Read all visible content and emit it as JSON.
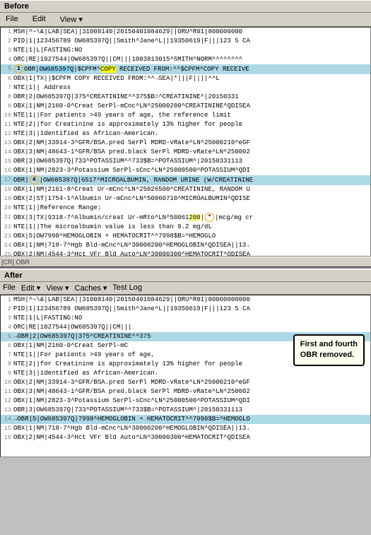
{
  "before": {
    "section_label": "Before",
    "menubar": [
      "File",
      "Edit",
      "View"
    ],
    "lines": [
      {
        "num": "1",
        "text": "MSH|^~\\&|LAB|SEA||31008140|20150401084629||ORU^R01|800000000",
        "hl": ""
      },
      {
        "num": "2",
        "text": "PID|1|123456789 OW685397Q||Smith^Jane^L||19350619|F|||123 S CA",
        "hl": ""
      },
      {
        "num": "3",
        "text": "NTE|1|L|FASTING:NO",
        "hl": ""
      },
      {
        "num": "4",
        "text": "ORC|RE|1027544|OW685397Q||CM|||1003813015^SMITH^NORM^^^^^^^^",
        "hl": ""
      },
      {
        "num": "5",
        "text": "OBR|1|OW685397Q|$CPFM^COPY RECEIVED FROM:^^$CPFM^COPY RECEIVE",
        "hl": "blue",
        "has_copy": true
      },
      {
        "num": "6",
        "text": "OBX|1|TX||$CPFM COPY RECEIVED FROM:^^SEA|*|||F||||^^L",
        "hl": "",
        "has_arrow": true
      },
      {
        "num": "7",
        "text": "NTE|1||  Address",
        "hl": ""
      },
      {
        "num": "8",
        "text": "OBR|2|OW685397Q|375^CREATININE^^375$B=^CREATININE^|20150331",
        "hl": ""
      },
      {
        "num": "9",
        "text": "OBX|1|NM|2160-0^Creat SerPl-mCnc^LN^25000200^CREATININE^QDISEA",
        "hl": ""
      },
      {
        "num": "10",
        "text": "NTE|1||For patients >49 years of age, the reference limit",
        "hl": ""
      },
      {
        "num": "11",
        "text": "NTE|2||for Creatinine is approximately 13% higher for people",
        "hl": ""
      },
      {
        "num": "12",
        "text": "NTE|3||identified as African-American.",
        "hl": ""
      },
      {
        "num": "13",
        "text": "OBX|2|NM|33914-3^GFR/BSA.pred SerPl MDRD-vRate^LN^25000210^eGF",
        "hl": ""
      },
      {
        "num": "14",
        "text": "OBX|3|NM|48643-1^GFR/BSA pred.black SerPl MDRD-vRate^LN^250002",
        "hl": ""
      },
      {
        "num": "15",
        "text": "OBR|3|OW685397Q|733^POTASSIUM^^733$B=^POTASSIUM^|20150331113",
        "hl": ""
      },
      {
        "num": "16",
        "text": "OBX|1|NM|2823-3^Potassium SerPl-sCnc^LN^25000500^POTASSIUM^QDI",
        "hl": ""
      },
      {
        "num": "17",
        "text": "OBR|4|OW685397Q|6517^MICROALBUMIN, RANDOM URINE (W/CREATININE",
        "hl": "blue",
        "circle": "4"
      },
      {
        "num": "18",
        "text": "OBX|1|NM|2161-8^Creat Ur-mCnc^LN^25026500^CREATININE, RANDOM U",
        "hl": ""
      },
      {
        "num": "19",
        "text": "OBX|2|ST|1754-1^Albumin Ur-mCnc^LN^50060710^MICROALBUMIN^QDISE",
        "hl": ""
      },
      {
        "num": "20",
        "text": "NTE|1||Reference Range:",
        "hl": ""
      },
      {
        "num": "21",
        "text": "OBX|3|TX|9318-7^Albumin/creat Ur-mRto^LN^50061200|*|mcg/mg cr",
        "hl": "",
        "has_circle2": true
      },
      {
        "num": "22",
        "text": "NTE|1||The microalbumin value is less than 0.2 mg/dL",
        "hl": ""
      },
      {
        "num": "23",
        "text": "OBX|5|OW7998^HEMOGLOBIN + HEMATOCRIT^^7998$B=^HEMOGLO",
        "hl": ""
      },
      {
        "num": "24",
        "text": "OBX|1|NM|718-7^Hgb Bld-mCnc^LN^30000200^HEMOGLOBIN^QDISEA||13.",
        "hl": ""
      },
      {
        "num": "25",
        "text": "OBX|2|NM|4544-3^Hct VFr Bld Auto^LN^30000300^HEMATOCRIT^QDISEA",
        "hl": ""
      }
    ],
    "scrollbar_text": "[CR] OBR"
  },
  "after": {
    "section_label": "After",
    "menubar": [
      "File",
      "Edit",
      "View",
      "Caches",
      "Test Log"
    ],
    "callout": {
      "line1": "First and fourth",
      "line2": "OBR removed."
    },
    "lines": [
      {
        "num": "1",
        "text": "MSH|^~\\&|LAB|SEA||31008140|20150401084629||ORU^R01|80000000000",
        "hl": ""
      },
      {
        "num": "2",
        "text": "PID|1|123456789 OW685397Q||Smith^Jane^L||19350619|F|||123 S CA",
        "hl": ""
      },
      {
        "num": "3",
        "text": "NTE|1|L|FASTING:NO",
        "hl": ""
      },
      {
        "num": "4",
        "text": "ORC|RE|1027544|OW685397Q||CM|||",
        "hl": ""
      },
      {
        "num": "5",
        "text": "OBR|2|OW685397Q|375^CREATININE^^375",
        "hl": "blue",
        "has_arrow": true
      },
      {
        "num": "6",
        "text": "OBX|1|NM|2160-0^Creat SerPl-mC",
        "hl": ""
      },
      {
        "num": "7",
        "text": "NTE|1||For patients >49 years of age,",
        "hl": ""
      },
      {
        "num": "8",
        "text": "NTE|2||for Creatinine is approximately 13% higher for people",
        "hl": ""
      },
      {
        "num": "9",
        "text": "NTE|3||identified as African-American.",
        "hl": ""
      },
      {
        "num": "10",
        "text": "OBX|2|NM|33914-3^GFR/BSA.pred SerPl MDRD-vRate^LN^25000210^eGF",
        "hl": ""
      },
      {
        "num": "11",
        "text": "OBX|3|NM|48643-1^GFR/BSA pred.black SerPl MDRD-vRate^LN^250002",
        "hl": ""
      },
      {
        "num": "12",
        "text": "OBX|1|NM|2823-3^Potassium SerPl-sCnc^LN^25000500^POTASSIUM^QDI",
        "hl": ""
      },
      {
        "num": "13",
        "text": "OBR|3|OW685397Q|733^POTASSIUM^^733$B=^POTASSIUM^|20150331113",
        "hl": ""
      },
      {
        "num": "14",
        "text": "OBR|5|OW685397Q|7998^HEMOGLOBIN + HEMATOCRIT^^7998$B=^HEMOGLO",
        "hl": "blue",
        "has_arrow2": true
      },
      {
        "num": "15",
        "text": "OBX|1|NM|718-7^Hgb Bld-mCnc^LN^30000200^HEMOGLOBIN^QDISEA||13.",
        "hl": ""
      },
      {
        "num": "16",
        "text": "OBX|2|NM|4544-3^Hct VFr Bld Auto^LN^30000300^HEMATOCRIT^QDISEA",
        "hl": ""
      }
    ]
  }
}
